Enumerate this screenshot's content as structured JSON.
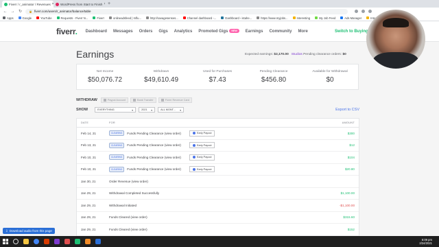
{
  "browser": {
    "tabs": [
      {
        "title": "Fiverr / r_animator / Revenues",
        "active": true,
        "color": "#1dbf73"
      },
      {
        "title": "WordPress from Start to Finish",
        "active": false,
        "color": "#e0245e"
      }
    ],
    "new_tab": "+",
    "url": "fiverr.com/users/r_animator/balance/table",
    "bookmarks": [
      {
        "label": "Apps",
        "color": "#5f6368"
      },
      {
        "label": "Google",
        "color": "#4285f4"
      },
      {
        "label": "YouTube",
        "color": "#ff0000"
      },
      {
        "label": "Requests - Fiverr N...",
        "color": "#1dbf73"
      },
      {
        "label": "Fiverr",
        "color": "#1dbf73"
      },
      {
        "label": "onlineadsfeed | Influ...",
        "color": "#888888"
      },
      {
        "label": "http://savagesenses...",
        "color": "#888888"
      },
      {
        "label": "Channel dashboard -...",
        "color": "#ff0000"
      },
      {
        "label": "Dashboard ‹ istahe...",
        "color": "#21759b"
      },
      {
        "label": "https://www.myjobs...",
        "color": "#888888"
      },
      {
        "label": "Interesting",
        "color": "#f4b400"
      },
      {
        "label": "My Job Feed",
        "color": "#6fda44"
      },
      {
        "label": "Ads Manager",
        "color": "#1877f2"
      },
      {
        "label": "Interes",
        "color": "#f4b400"
      }
    ]
  },
  "header": {
    "logo_text": "fiverr",
    "logo_dot": ".",
    "nav": [
      "Dashboard",
      "Messages",
      "Orders",
      "Gigs",
      "Analytics",
      "Promoted Gigs",
      "Earnings",
      "Community",
      "More"
    ],
    "new_badge": "NEW",
    "switch_label": "Switch to Buying"
  },
  "page": {
    "title": "Earnings",
    "expected_label": "Expected earnings:",
    "expected_value": "$2,170.00",
    "studios_label": "Studios",
    "pending_orders_label": "Pending clearance orders:",
    "pending_orders_value": "$0"
  },
  "stats": [
    {
      "label": "Net Income",
      "value": "$50,076.72"
    },
    {
      "label": "Withdrawn",
      "value": "$49,610.49"
    },
    {
      "label": "Used for Purchases",
      "value": "$7.43"
    },
    {
      "label": "Pending Clearance",
      "value": "$456.80"
    },
    {
      "label": "Available for Withdrawal",
      "value": "$0"
    }
  ],
  "withdraw": {
    "label": "WITHDRAW",
    "buttons": [
      "Paypal Account",
      "Bank Transfer",
      "Fiverr Revenue Card"
    ]
  },
  "filters": {
    "show_label": "SHOW",
    "selects": [
      "EVERYTHING",
      "2021",
      "ALL MONT..."
    ],
    "export_label": "Export to CSV"
  },
  "table": {
    "columns": [
      "DATE",
      "FOR",
      "AMOUNT"
    ],
    "rows": [
      {
        "date": "Feb 14, 21",
        "badge": "CLEARING",
        "desc": "Funds Pending Clearance (view order)",
        "payout": "Early Payout",
        "amount": "$300",
        "kind": "pos"
      },
      {
        "date": "Feb 13, 21",
        "badge": "CLEARING",
        "desc": "Funds Pending Clearance (view order)",
        "payout": "Early Payout",
        "amount": "$12",
        "kind": "pos"
      },
      {
        "date": "Feb 10, 21",
        "badge": "CLEARING",
        "desc": "Funds Pending Clearance (view order)",
        "payout": "Early Payout",
        "amount": "$104",
        "kind": "pos"
      },
      {
        "date": "Feb 10, 21",
        "badge": "CLEARING",
        "desc": "Funds Pending Clearance (view order)",
        "payout": "Early Payout",
        "amount": "$20.80",
        "kind": "pos"
      },
      {
        "date": "Jan 30, 21",
        "badge": "",
        "desc": "Order Revenue (view order)",
        "payout": "",
        "amount": "",
        "kind": "pos"
      },
      {
        "date": "Jan 29, 21",
        "badge": "",
        "desc": "Withdrawal Completed Successfully",
        "payout": "",
        "amount": "$1,100.00",
        "kind": "pos"
      },
      {
        "date": "Jan 29, 21",
        "badge": "",
        "desc": "Withdrawal Initiated",
        "payout": "",
        "amount": "-$1,100.00",
        "kind": "neg"
      },
      {
        "date": "Jan 29, 21",
        "badge": "",
        "desc": "Funds Cleared (view order)",
        "payout": "",
        "amount": "$315.60",
        "kind": "pos"
      },
      {
        "date": "Jan 29, 21",
        "badge": "",
        "desc": "Funds Cleared (view order)",
        "payout": "",
        "amount": "$152",
        "kind": "pos"
      },
      {
        "date": "Jan 28, 21",
        "badge": "",
        "desc": "Funds Cleared (view order)",
        "payout": "",
        "amount": "",
        "kind": "pos"
      }
    ]
  },
  "download_bar": {
    "label": "Download audio from this page"
  },
  "taskbar": {
    "time": "6:09 pm",
    "date": "2/24/2021"
  }
}
